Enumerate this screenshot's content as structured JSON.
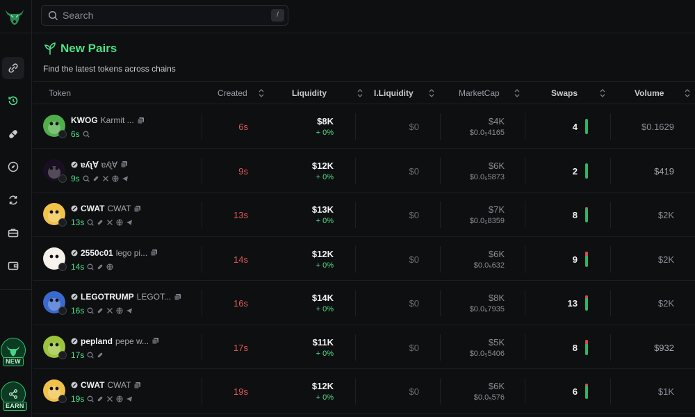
{
  "search": {
    "placeholder": "Search",
    "shortcut": "/"
  },
  "page": {
    "title": "New Pairs",
    "subtitle": "Find the latest tokens across chains"
  },
  "sidebar": {
    "items": [
      {
        "icon": "link-icon",
        "active": true
      },
      {
        "icon": "history-icon",
        "active": false
      },
      {
        "icon": "pill-icon",
        "active": false
      },
      {
        "icon": "compass-icon",
        "active": false
      },
      {
        "icon": "swap-arrows-icon",
        "active": false
      },
      {
        "icon": "briefcase-icon",
        "active": false
      },
      {
        "icon": "wallet-icon",
        "active": false
      }
    ],
    "promo_new": "NEW",
    "promo_earn": "EARN"
  },
  "columns": {
    "token": "Token",
    "created": "Created",
    "liquidity": "Liquidity",
    "iliquidity": "I.Liquidity",
    "marketcap": "MarketCap",
    "swaps": "Swaps",
    "volume": "Volume"
  },
  "rows": [
    {
      "symbol": "KWOG",
      "name": "Karmit ...",
      "age": "6s",
      "created": "6s",
      "liquidity": "$8K",
      "liq_change": "+ 0%",
      "iliquidity": "$0",
      "marketcap": "$4K",
      "price": "$0.0₅4165",
      "swaps": "4",
      "sell_ratio": 0.0,
      "volume": "$0.1629",
      "avatar_color": "#4fae4a",
      "launch_icon": false
    },
    {
      "symbol": "ɐʎʅ∀",
      "name": "ɐʎʅ∀",
      "age": "9s",
      "created": "9s",
      "liquidity": "$12K",
      "liq_change": "+ 0%",
      "iliquidity": "$0",
      "marketcap": "$6K",
      "price": "$0.0₅5873",
      "swaps": "2",
      "sell_ratio": 0.0,
      "volume": "$419",
      "avatar_color": "#1a0f22",
      "launch_icon": true
    },
    {
      "symbol": "CWAT",
      "name": "CWAT",
      "age": "13s",
      "created": "13s",
      "liquidity": "$13K",
      "liq_change": "+ 0%",
      "iliquidity": "$0",
      "marketcap": "$7K",
      "price": "$0.0₅8359",
      "swaps": "8",
      "sell_ratio": 0.1,
      "volume": "$2K",
      "avatar_color": "#f0c24a",
      "launch_icon": true
    },
    {
      "symbol": "2550c01",
      "name": "lego pi...",
      "age": "14s",
      "created": "14s",
      "liquidity": "$12K",
      "liq_change": "+ 0%",
      "iliquidity": "$0",
      "marketcap": "$6K",
      "price": "$0.0₅632",
      "swaps": "9",
      "sell_ratio": 0.3,
      "volume": "$2K",
      "avatar_color": "#f4f1ea",
      "launch_icon": true
    },
    {
      "symbol": "LEGOTRUMP",
      "name": "LEGOT...",
      "age": "16s",
      "created": "16s",
      "liquidity": "$14K",
      "liq_change": "+ 0%",
      "iliquidity": "$0",
      "marketcap": "$8K",
      "price": "$0.0₅7935",
      "swaps": "13",
      "sell_ratio": 0.2,
      "volume": "$2K",
      "avatar_color": "#3a6ad0",
      "launch_icon": true
    },
    {
      "symbol": "pepland",
      "name": "pepe w...",
      "age": "17s",
      "created": "17s",
      "liquidity": "$11K",
      "liq_change": "+ 0%",
      "iliquidity": "$0",
      "marketcap": "$5K",
      "price": "$0.0₅5406",
      "swaps": "8",
      "sell_ratio": 0.3,
      "volume": "$932",
      "avatar_color": "#9bc33b",
      "launch_icon": true
    },
    {
      "symbol": "CWAT",
      "name": "CWAT",
      "age": "19s",
      "created": "19s",
      "liquidity": "$12K",
      "liq_change": "+ 0%",
      "iliquidity": "$0",
      "marketcap": "$6K",
      "price": "$0.0₅576",
      "swaps": "6",
      "sell_ratio": 0.15,
      "volume": "$1K",
      "avatar_color": "#f0c24a",
      "launch_icon": true
    }
  ],
  "colors": {
    "accent": "#4ee08a",
    "red": "#e25a5a",
    "buy": "#2fb56a",
    "sell": "#d94848"
  }
}
